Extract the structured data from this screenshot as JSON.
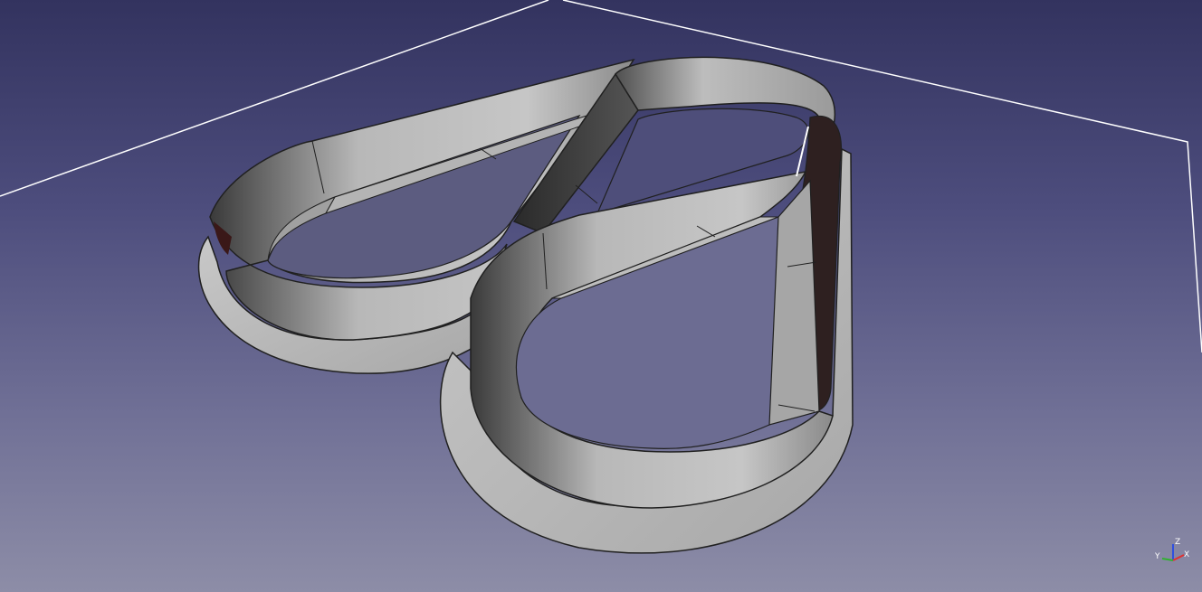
{
  "viewport": {
    "background_top": "#33335f",
    "background_bottom": "#8d8da7",
    "grid_line_color": "#ffffff",
    "model_color": "#b4b4b4",
    "edge_color": "#202020",
    "selection_color": "#ffffff"
  },
  "axis_triad": {
    "x_label": "X",
    "y_label": "Y",
    "z_label": "Z",
    "x_color": "#e03030",
    "y_color": "#30b030",
    "z_color": "#3050e0"
  }
}
